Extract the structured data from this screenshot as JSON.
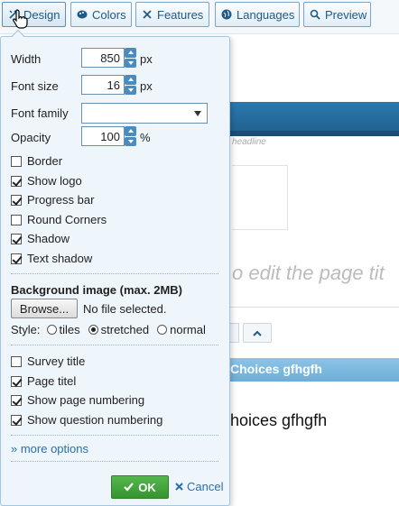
{
  "toolbar": {
    "buttons": [
      {
        "label": "Design",
        "icon": "design-icon"
      },
      {
        "label": "Colors",
        "icon": "palette-icon"
      },
      {
        "label": "Features",
        "icon": "tools-icon"
      },
      {
        "label": "Languages",
        "icon": "globe-icon"
      },
      {
        "label": "Preview",
        "icon": "search-icon"
      }
    ]
  },
  "background_page": {
    "headline": "headline",
    "title_text": "o edit the page tit",
    "question_bar": "Choices gfhgfh",
    "question_text": "hoices gfhgfh"
  },
  "design_popup": {
    "width": {
      "label": "Width",
      "value": "850",
      "unit": "px"
    },
    "font_size": {
      "label": "Font size",
      "value": "16",
      "unit": "px"
    },
    "font_family": {
      "label": "Font family",
      "value": ""
    },
    "opacity": {
      "label": "Opacity",
      "value": "100",
      "unit": "%"
    },
    "options": [
      {
        "label": "Border",
        "checked": false
      },
      {
        "label": "Show logo",
        "checked": true
      },
      {
        "label": "Progress bar",
        "checked": true
      },
      {
        "label": "Round Corners",
        "checked": false
      },
      {
        "label": "Shadow",
        "checked": true
      },
      {
        "label": "Text shadow",
        "checked": true
      }
    ],
    "background_image": {
      "heading": "Background image (max. 2MB)",
      "browse_label": "Browse...",
      "file_status": "No file selected.",
      "style_label": "Style:",
      "styles": [
        {
          "label": "tiles",
          "selected": false
        },
        {
          "label": "stretched",
          "selected": true
        },
        {
          "label": "normal",
          "selected": false
        }
      ]
    },
    "page_options": [
      {
        "label": "Survey title",
        "checked": false
      },
      {
        "label": "Page titel",
        "checked": true
      },
      {
        "label": "Show page numbering",
        "checked": true
      },
      {
        "label": "Show question numbering",
        "checked": true
      }
    ],
    "more_options": "» more options",
    "ok_label": "OK",
    "cancel_label": "Cancel"
  },
  "colors": {
    "accent": "#2a6fb0",
    "header_blue": "#2b78ad",
    "ok_green": "#3fa336"
  }
}
